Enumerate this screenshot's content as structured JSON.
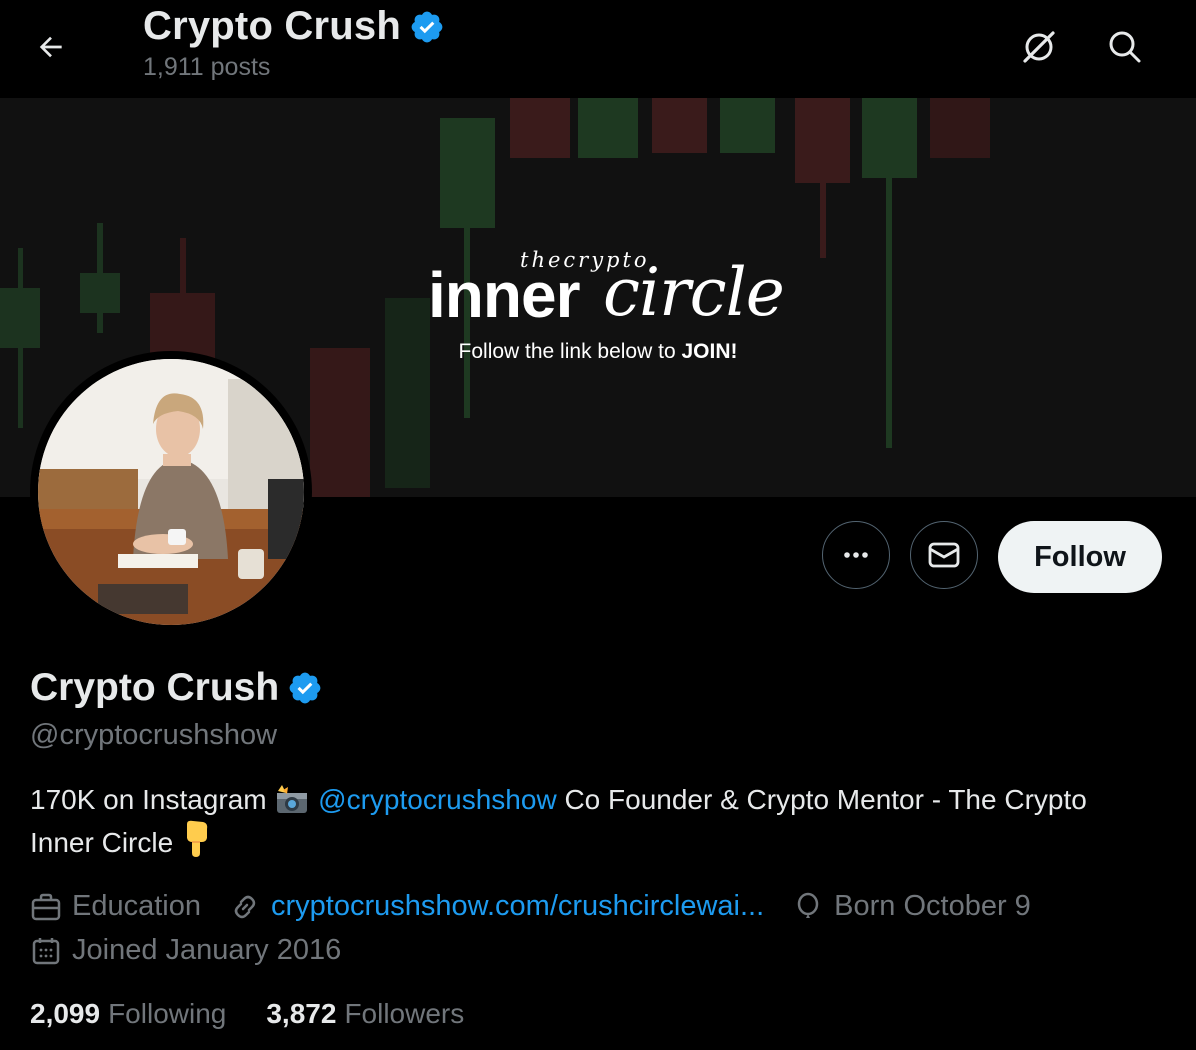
{
  "header": {
    "title": "Crypto Crush",
    "posts_count": "1,911 posts"
  },
  "banner": {
    "logo_small": "thecrypto",
    "logo_inner": "inner",
    "logo_circle": "circle",
    "tagline_prefix": "Follow the link below to ",
    "tagline_bold": "JOIN!"
  },
  "actions": {
    "follow_label": "Follow"
  },
  "profile": {
    "name": "Crypto Crush",
    "handle": "@cryptocrushshow",
    "bio": {
      "part1": "170K on Instagram",
      "mention": "@cryptocrushshow",
      "part2": "Co Founder & Crypto Mentor - The Crypto Inner Circle"
    },
    "category": "Education",
    "website": "cryptocrushshow.com/crushcirclewai...",
    "birthday": "Born October 9",
    "joined": "Joined January 2016",
    "following_count": "2,099",
    "following_label": "Following",
    "followers_count": "3,872",
    "followers_label": "Followers"
  },
  "icons": {
    "back": "arrow-left-icon",
    "grok": "grok-icon",
    "search": "search-icon",
    "more": "more-icon",
    "message": "envelope-icon",
    "verified": "verified-badge-icon",
    "category": "briefcase-icon",
    "link": "link-icon",
    "birthday": "balloon-icon",
    "calendar": "calendar-icon"
  },
  "colors": {
    "background": "#000000",
    "accent": "#1d9bf0",
    "muted": "#71767b",
    "text": "#e7e9ea"
  }
}
